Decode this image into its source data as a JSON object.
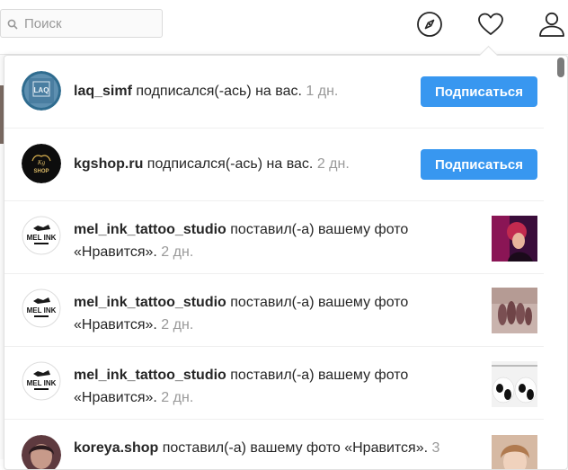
{
  "search": {
    "placeholder": "Поиск"
  },
  "nav": {
    "explore": "compass-icon",
    "activity": "heart-icon",
    "profile": "user-icon"
  },
  "colors": {
    "follow_button": "#3897f0",
    "muted_text": "#999999"
  },
  "notifications": [
    {
      "username": "laq_simf",
      "action": "подписался(-ась) на вас.",
      "time": "1 дн.",
      "button": "Подписаться",
      "avatar_text": "LAQ"
    },
    {
      "username": "kgshop.ru",
      "action": "подписался(-ась) на вас.",
      "time": "2 дн.",
      "button": "Подписаться",
      "avatar_text": "SHOP"
    },
    {
      "username": "mel_ink_tattoo_studio",
      "action": "поставил(-а) вашему фото",
      "action2": "«Нравится».",
      "time": "2 дн.",
      "avatar_text": "MEL INK"
    },
    {
      "username": "mel_ink_tattoo_studio",
      "action": "поставил(-а) вашему фото",
      "action2": "«Нравится».",
      "time": "2 дн.",
      "avatar_text": "MEL INK"
    },
    {
      "username": "mel_ink_tattoo_studio",
      "action": "поставил(-а) вашему фото",
      "action2": "«Нравится».",
      "time": "2 дн.",
      "avatar_text": "MEL INK"
    },
    {
      "username": "koreya.shop",
      "action": "поставил(-а) вашему фото «Нравится».",
      "time": "3"
    }
  ]
}
